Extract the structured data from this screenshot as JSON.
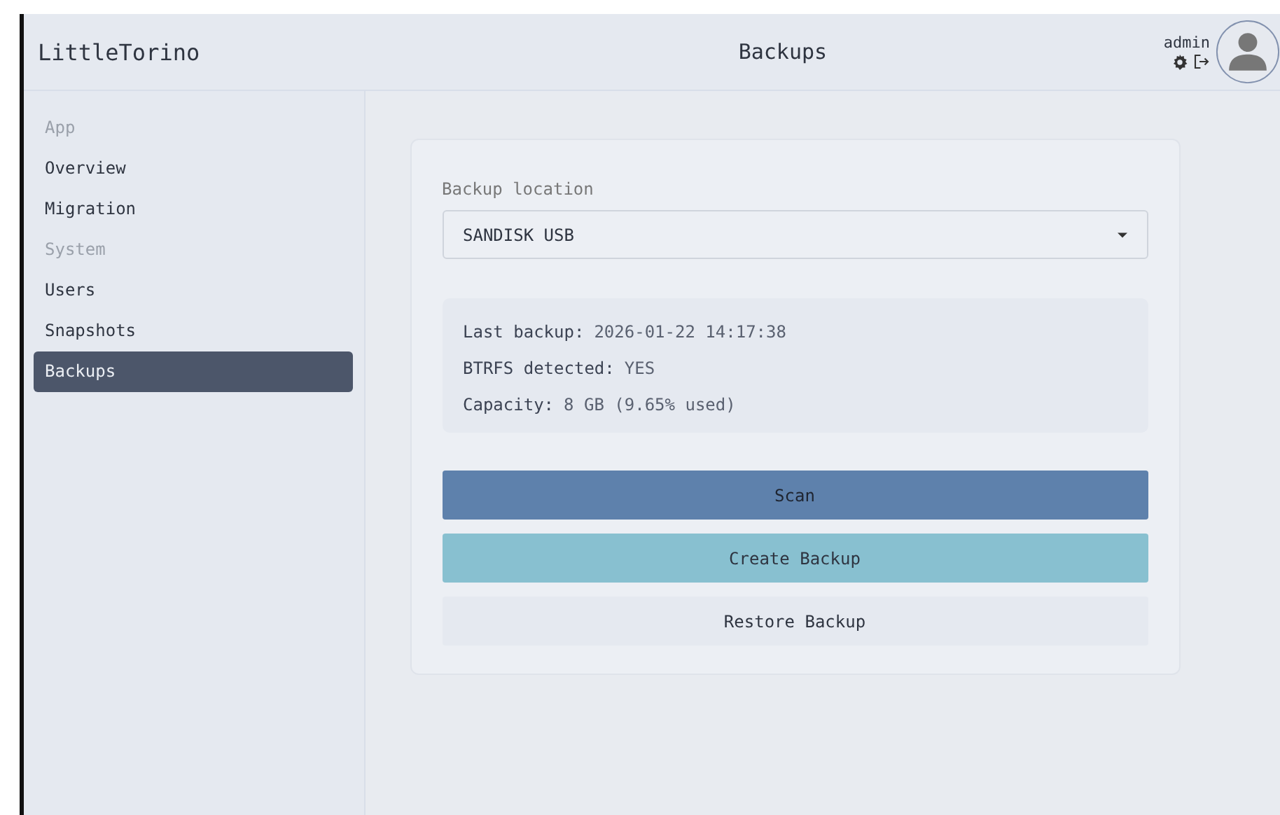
{
  "app": {
    "brand": "LittleTorino",
    "title": "Backups",
    "user": "admin"
  },
  "sidebar": {
    "items": [
      {
        "kind": "section",
        "label": "App"
      },
      {
        "kind": "link",
        "label": "Overview",
        "selected": false
      },
      {
        "kind": "link",
        "label": "Migration",
        "selected": false
      },
      {
        "kind": "section",
        "label": "System"
      },
      {
        "kind": "link",
        "label": "Users",
        "selected": false
      },
      {
        "kind": "link",
        "label": "Snapshots",
        "selected": false
      },
      {
        "kind": "link",
        "label": "Backups",
        "selected": true
      }
    ]
  },
  "backup": {
    "location_label": "Backup location",
    "location": "SANDISK USB",
    "info": [
      {
        "label": "Last backup:",
        "value": "2026-01-22 14:17:38"
      },
      {
        "label": "BTRFS detected:",
        "value": "YES"
      },
      {
        "label": "Capacity:",
        "value": "8 GB (9.65% used)"
      }
    ],
    "buttons": [
      {
        "label": "Scan",
        "kind": "primary"
      },
      {
        "label": "Create Backup",
        "kind": "accent"
      },
      {
        "label": "Restore Backup",
        "kind": "plain"
      }
    ]
  }
}
